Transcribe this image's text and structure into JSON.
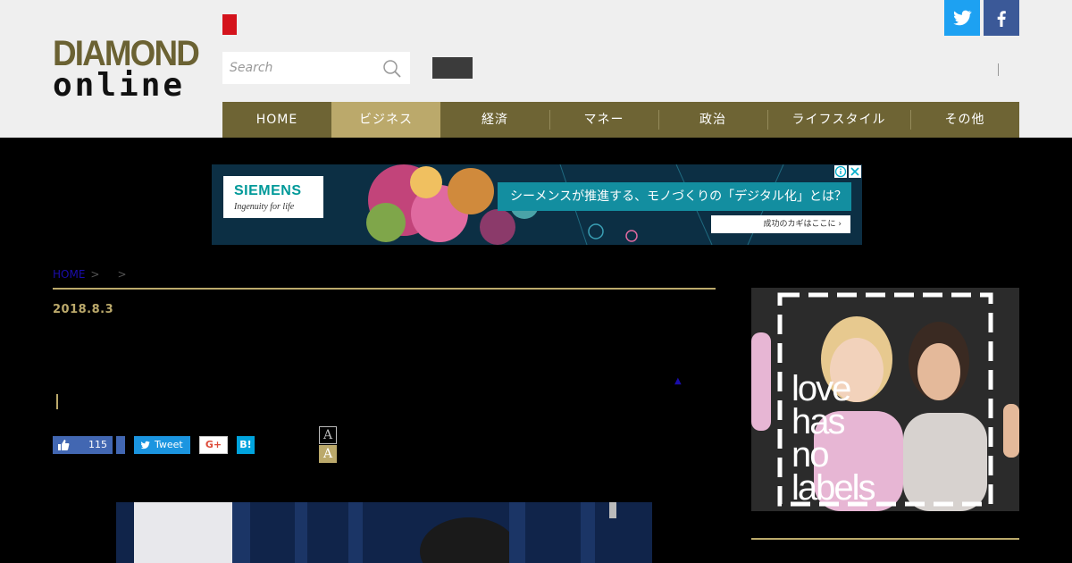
{
  "header": {
    "logo_line1": "DIAMOND",
    "logo_line2": "online",
    "search_placeholder": "Search",
    "separator": "|"
  },
  "nav": {
    "items": [
      {
        "label": "HOME"
      },
      {
        "label": "ビジネス"
      },
      {
        "label": "経済"
      },
      {
        "label": "マネー"
      },
      {
        "label": "政治"
      },
      {
        "label": "ライフスタイル"
      },
      {
        "label": "その他"
      }
    ]
  },
  "ad_banner": {
    "brand": "SIEMENS",
    "tagline": "Ingenuity for life",
    "headline": "シーメンスが推進する、モノづくりの「デジタル化」とは？",
    "cta": "成功のカギはここに ›"
  },
  "breadcrumb": {
    "home": "HOME",
    "sep1": ">",
    "sep2": ">"
  },
  "article": {
    "date": "2018.8.3",
    "arrow": "▲",
    "like_count": "115",
    "tweet_label": "Tweet",
    "gplus_label": "G+",
    "hatena_label": "B!",
    "font_small": "A",
    "font_large": "A"
  },
  "side_ad": {
    "text_line1": "love",
    "text_line2": "has",
    "text_line3": "no",
    "text_line4": "labels"
  },
  "colors": {
    "nav_bg": "#6e6434",
    "nav_active": "#bba96b",
    "accent_gold": "#bba96b",
    "twitter": "#1da1f2",
    "facebook": "#3b5998"
  },
  "icons": [
    "search-icon",
    "twitter-icon",
    "facebook-icon",
    "thumbs-up-icon",
    "twitter-bird-icon",
    "info-icon",
    "close-icon"
  ]
}
